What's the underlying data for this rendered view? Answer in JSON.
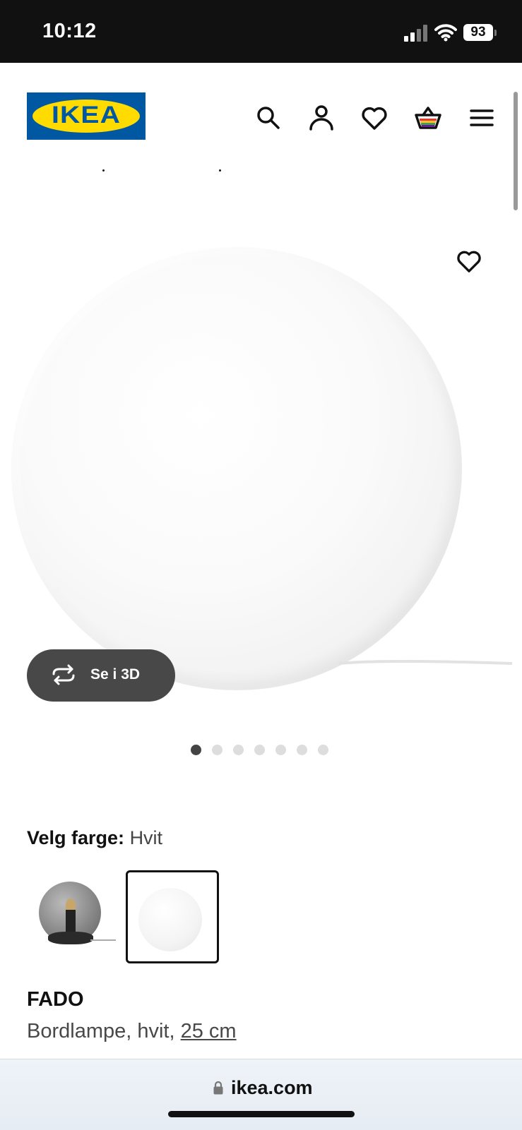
{
  "status_bar": {
    "time": "10:12",
    "battery": "93",
    "icons": [
      "signal-icon",
      "wifi-icon",
      "battery-icon"
    ]
  },
  "header": {
    "logo": "IKEA",
    "icons": [
      "search-icon",
      "account-icon",
      "heart-icon",
      "cart-icon",
      "menu-icon"
    ]
  },
  "product_image": {
    "view_3d_label": "Se i 3D",
    "carousel_count": 7,
    "carousel_active_index": 0
  },
  "color_picker": {
    "label": "Velg farge:",
    "selected_value": "Hvit",
    "options": [
      "grey-glass-lamp",
      "white-glass-lamp"
    ],
    "selected_index": 1
  },
  "product": {
    "name": "FADO",
    "description": "Bordlampe, hvit,",
    "size_link": "25 cm"
  },
  "browser": {
    "url": "ikea.com"
  }
}
